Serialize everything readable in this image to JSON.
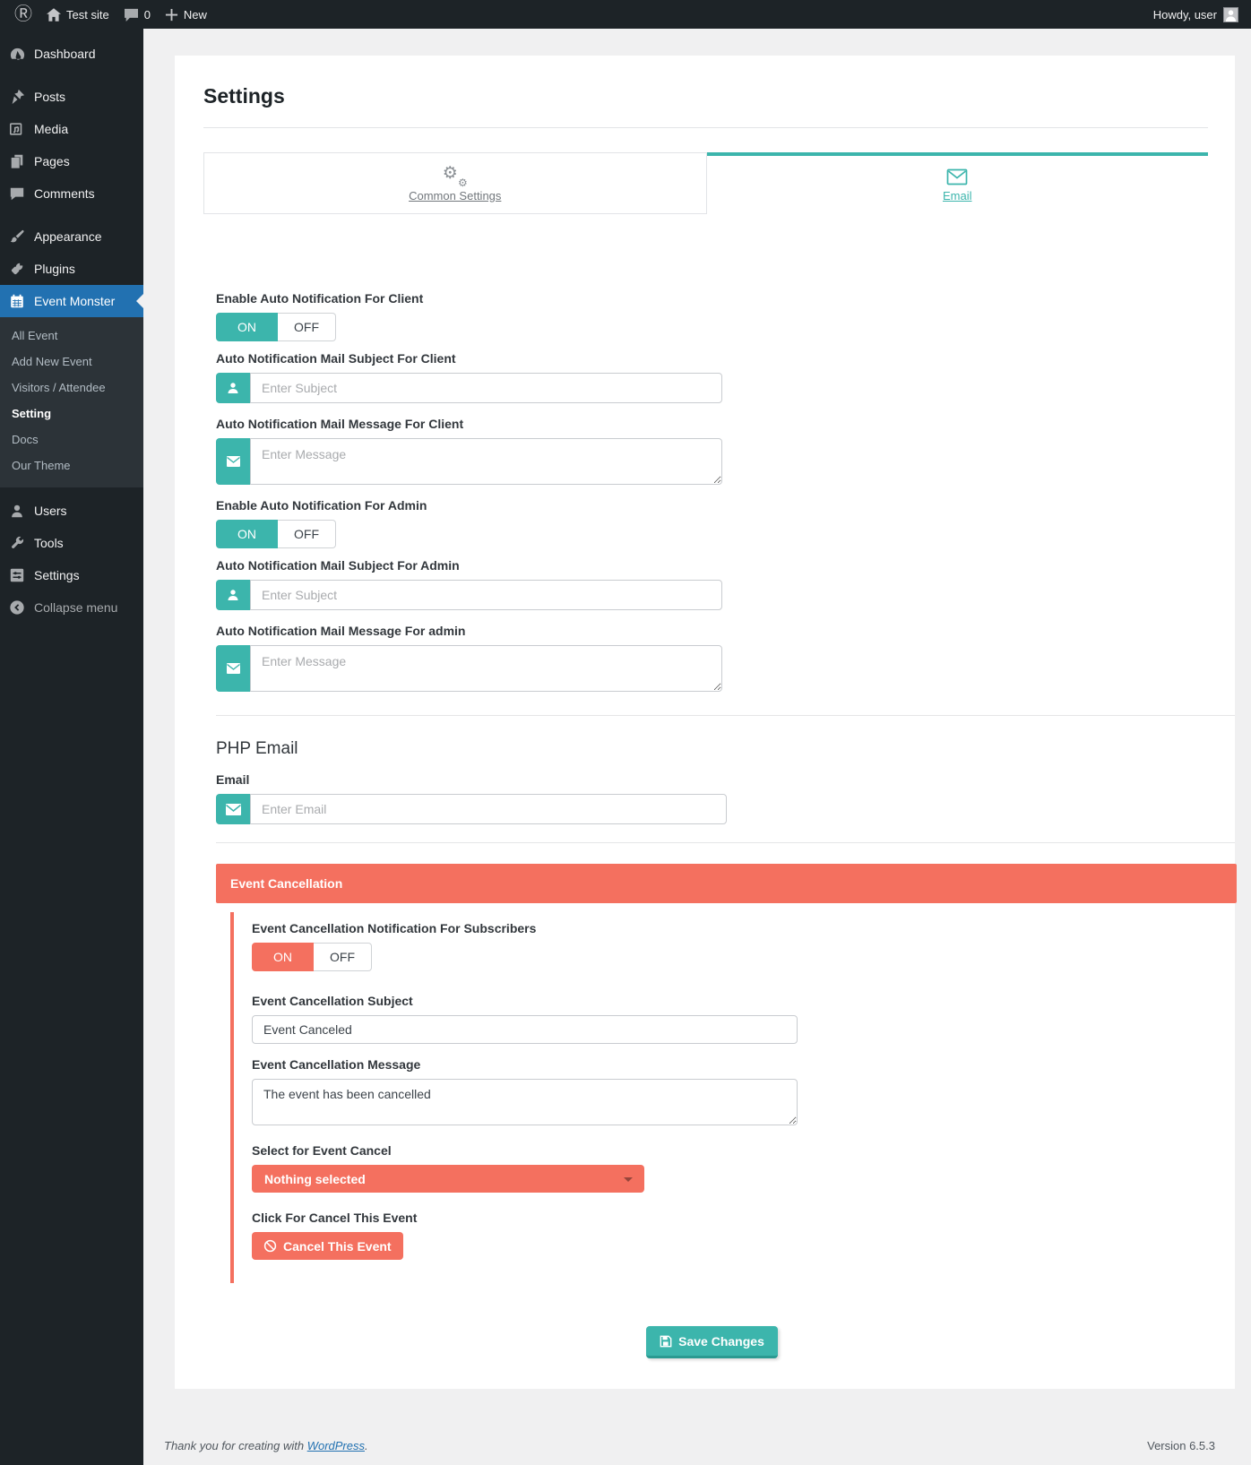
{
  "admin_bar": {
    "site_name": "Test site",
    "comments_count": "0",
    "new_label": "New",
    "howdy": "Howdy, user"
  },
  "sidebar": {
    "items": [
      {
        "label": "Dashboard",
        "icon": "dashboard-icon"
      },
      {
        "label": "Posts",
        "icon": "pushpin-icon"
      },
      {
        "label": "Media",
        "icon": "media-icon"
      },
      {
        "label": "Pages",
        "icon": "pages-icon"
      },
      {
        "label": "Comments",
        "icon": "comment-icon"
      },
      {
        "label": "Appearance",
        "icon": "appearance-icon"
      },
      {
        "label": "Plugins",
        "icon": "plugin-icon"
      },
      {
        "label": "Event Monster",
        "icon": "calendar-icon",
        "active": true
      }
    ],
    "submenu": {
      "items": [
        {
          "label": "All Event"
        },
        {
          "label": "Add New Event"
        },
        {
          "label": "Visitors / Attendee"
        },
        {
          "label": "Setting",
          "current": true
        },
        {
          "label": "Docs"
        },
        {
          "label": "Our Theme"
        }
      ]
    },
    "lower_items": [
      {
        "label": "Users",
        "icon": "users-icon"
      },
      {
        "label": "Tools",
        "icon": "tools-icon"
      },
      {
        "label": "Settings",
        "icon": "settings-icon"
      },
      {
        "label": "Collapse menu",
        "icon": "collapse-icon"
      }
    ]
  },
  "page": {
    "title": "Settings",
    "tabs": [
      {
        "label": "Common Settings",
        "icon": "gears-icon",
        "active": false
      },
      {
        "label": "Email",
        "icon": "envelope-icon",
        "active": true
      }
    ]
  },
  "toggle": {
    "on": "ON",
    "off": "OFF"
  },
  "email_tab": {
    "client": {
      "enable_label": "Enable Auto Notification For Client",
      "subject_label": "Auto Notification Mail Subject For Client",
      "subject_placeholder": "Enter Subject",
      "message_label": "Auto Notification Mail Message For Client",
      "message_placeholder": "Enter Message"
    },
    "admin": {
      "enable_label": "Enable Auto Notification For Admin",
      "subject_label": "Auto Notification Mail Subject For Admin",
      "subject_placeholder": "Enter Subject",
      "message_label": "Auto Notification Mail Message For admin",
      "message_placeholder": "Enter Message"
    },
    "php_email": {
      "heading": "PHP Email",
      "email_label": "Email",
      "email_placeholder": "Enter Email"
    },
    "cancellation": {
      "header": "Event Cancellation",
      "notification_label": "Event Cancellation Notification For Subscribers",
      "subject_label": "Event Cancellation Subject",
      "subject_value": "Event Canceled",
      "message_label": "Event Cancellation Message",
      "message_value": "The event has been cancelled",
      "select_label": "Select for Event Cancel",
      "select_value": "Nothing selected",
      "cancel_click_label": "Click For Cancel This Event",
      "cancel_button_label": "Cancel This Event"
    },
    "save_button_label": "Save Changes"
  },
  "footer": {
    "thanks_prefix": "Thank you for creating with ",
    "wordpress_link": "WordPress",
    "thanks_suffix": ".",
    "version": "Version 6.5.3"
  },
  "colors": {
    "teal": "#3cb5ac",
    "coral": "#f4705f",
    "menu_highlight": "#2271b1",
    "admin_dark": "#1d2327"
  }
}
